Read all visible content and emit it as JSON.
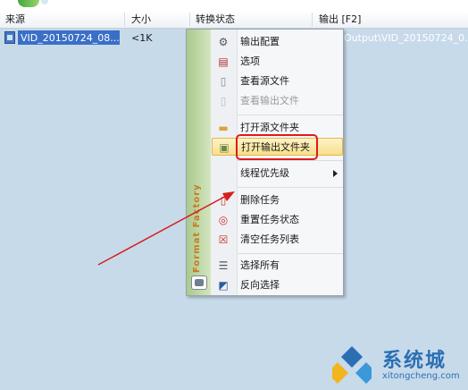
{
  "columns": {
    "source": "来源",
    "size": "大小",
    "status": "转换状态",
    "output": "输出 [F2]"
  },
  "file_row": {
    "name": "VID_20150724_08...",
    "size": "<1K",
    "output": "Output\\VID_20150724_0..."
  },
  "context_menu": {
    "side_brand": "Format Factory",
    "items": [
      {
        "label": "输出配置",
        "icon": "gear-icon"
      },
      {
        "label": "选项",
        "icon": "options-icon"
      },
      {
        "label": "查看源文件",
        "icon": "document-icon"
      },
      {
        "label": "查看输出文件",
        "icon": "document-icon",
        "disabled": true
      },
      {
        "label": "打开源文件夹",
        "icon": "folder-icon"
      },
      {
        "label": "打开输出文件夹",
        "icon": "folder-open-icon",
        "highlighted": true
      },
      {
        "label": "线程优先级",
        "submenu": true
      },
      {
        "label": "删除任务",
        "icon": "delete-icon"
      },
      {
        "label": "重置任务状态",
        "icon": "reset-icon"
      },
      {
        "label": "清空任务列表",
        "icon": "clear-list-icon"
      },
      {
        "label": "选择所有",
        "icon": "select-all-icon"
      },
      {
        "label": "反向选择",
        "icon": "invert-selection-icon"
      }
    ]
  },
  "annotation": {
    "highlight_color": "#e01a1a",
    "arrow_color": "#d42020"
  },
  "watermark": {
    "cn": "系统城",
    "en": "xitongcheng.com"
  },
  "colors": {
    "background": "#c7daea",
    "selection": "#3a6fc7",
    "menu_highlight": "#f8df8a",
    "brand_green": "#a9c98b",
    "brand_orange": "#c97a1e",
    "watermark_blue": "#2b6fb3"
  }
}
